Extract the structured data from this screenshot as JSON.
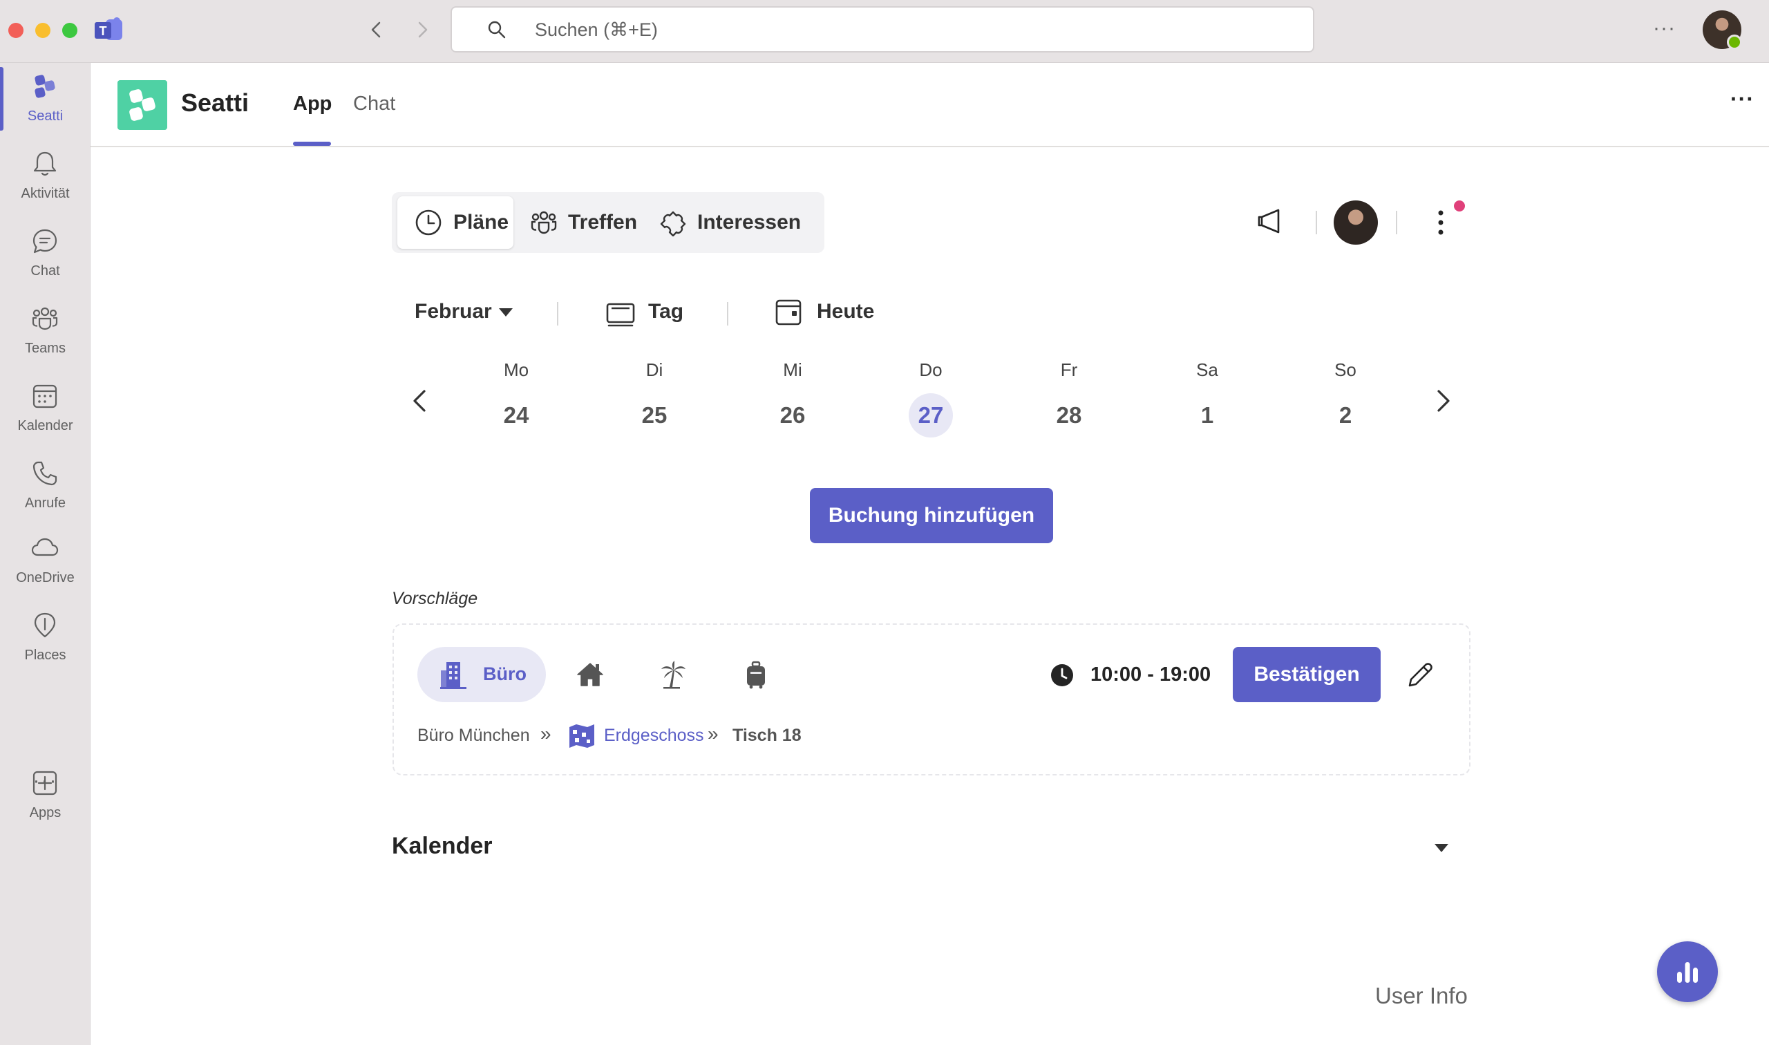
{
  "titlebar": {
    "search_placeholder": "Suchen (⌘+E)",
    "more_label": "···"
  },
  "rail": {
    "items": [
      {
        "label": "Seatti",
        "icon": "seatti-icon",
        "active": true
      },
      {
        "label": "Aktivität",
        "icon": "bell-icon"
      },
      {
        "label": "Chat",
        "icon": "chat-icon"
      },
      {
        "label": "Teams",
        "icon": "teams-icon"
      },
      {
        "label": "Kalender",
        "icon": "calendar-icon"
      },
      {
        "label": "Anrufe",
        "icon": "phone-icon"
      },
      {
        "label": "OneDrive",
        "icon": "cloud-icon"
      },
      {
        "label": "Places",
        "icon": "places-icon"
      },
      {
        "label": "Apps",
        "icon": "add-apps-icon"
      }
    ],
    "more_label": "···"
  },
  "header": {
    "app_name": "Seatti",
    "tabs": [
      {
        "label": "App",
        "active": true
      },
      {
        "label": "Chat",
        "active": false
      }
    ],
    "more_label": "···"
  },
  "segments": {
    "plaene": "Pläne",
    "treffen": "Treffen",
    "interessen": "Interessen",
    "active": "Pläne"
  },
  "toolbar": {
    "month": "Februar",
    "view": "Tag",
    "today": "Heute"
  },
  "week": {
    "days": [
      {
        "name": "Mo",
        "num": "24"
      },
      {
        "name": "Di",
        "num": "25"
      },
      {
        "name": "Mi",
        "num": "26"
      },
      {
        "name": "Do",
        "num": "27",
        "today": true
      },
      {
        "name": "Fr",
        "num": "28"
      },
      {
        "name": "Sa",
        "num": "1"
      },
      {
        "name": "So",
        "num": "2"
      }
    ]
  },
  "actions": {
    "add_booking": "Buchung hinzufügen"
  },
  "suggestions": {
    "label": "Vorschläge",
    "selected_type": "Büro",
    "types": [
      "office-icon",
      "home-icon",
      "palm-tree-icon",
      "suitcase-icon"
    ],
    "time": "10:00 - 19:00",
    "confirm": "Bestätigen",
    "breadcrumb": {
      "location": "Büro München",
      "floor": "Erdgeschoss",
      "desk": "Tisch 18"
    }
  },
  "calendar_section": {
    "title": "Kalender"
  },
  "footer": {
    "user_info": "User Info"
  },
  "colors": {
    "accent": "#5b5fc7",
    "accent_light": "#e8e8f5",
    "logo": "#4fd1a4",
    "notification": "#e0407a",
    "presence": "#6bb700"
  }
}
